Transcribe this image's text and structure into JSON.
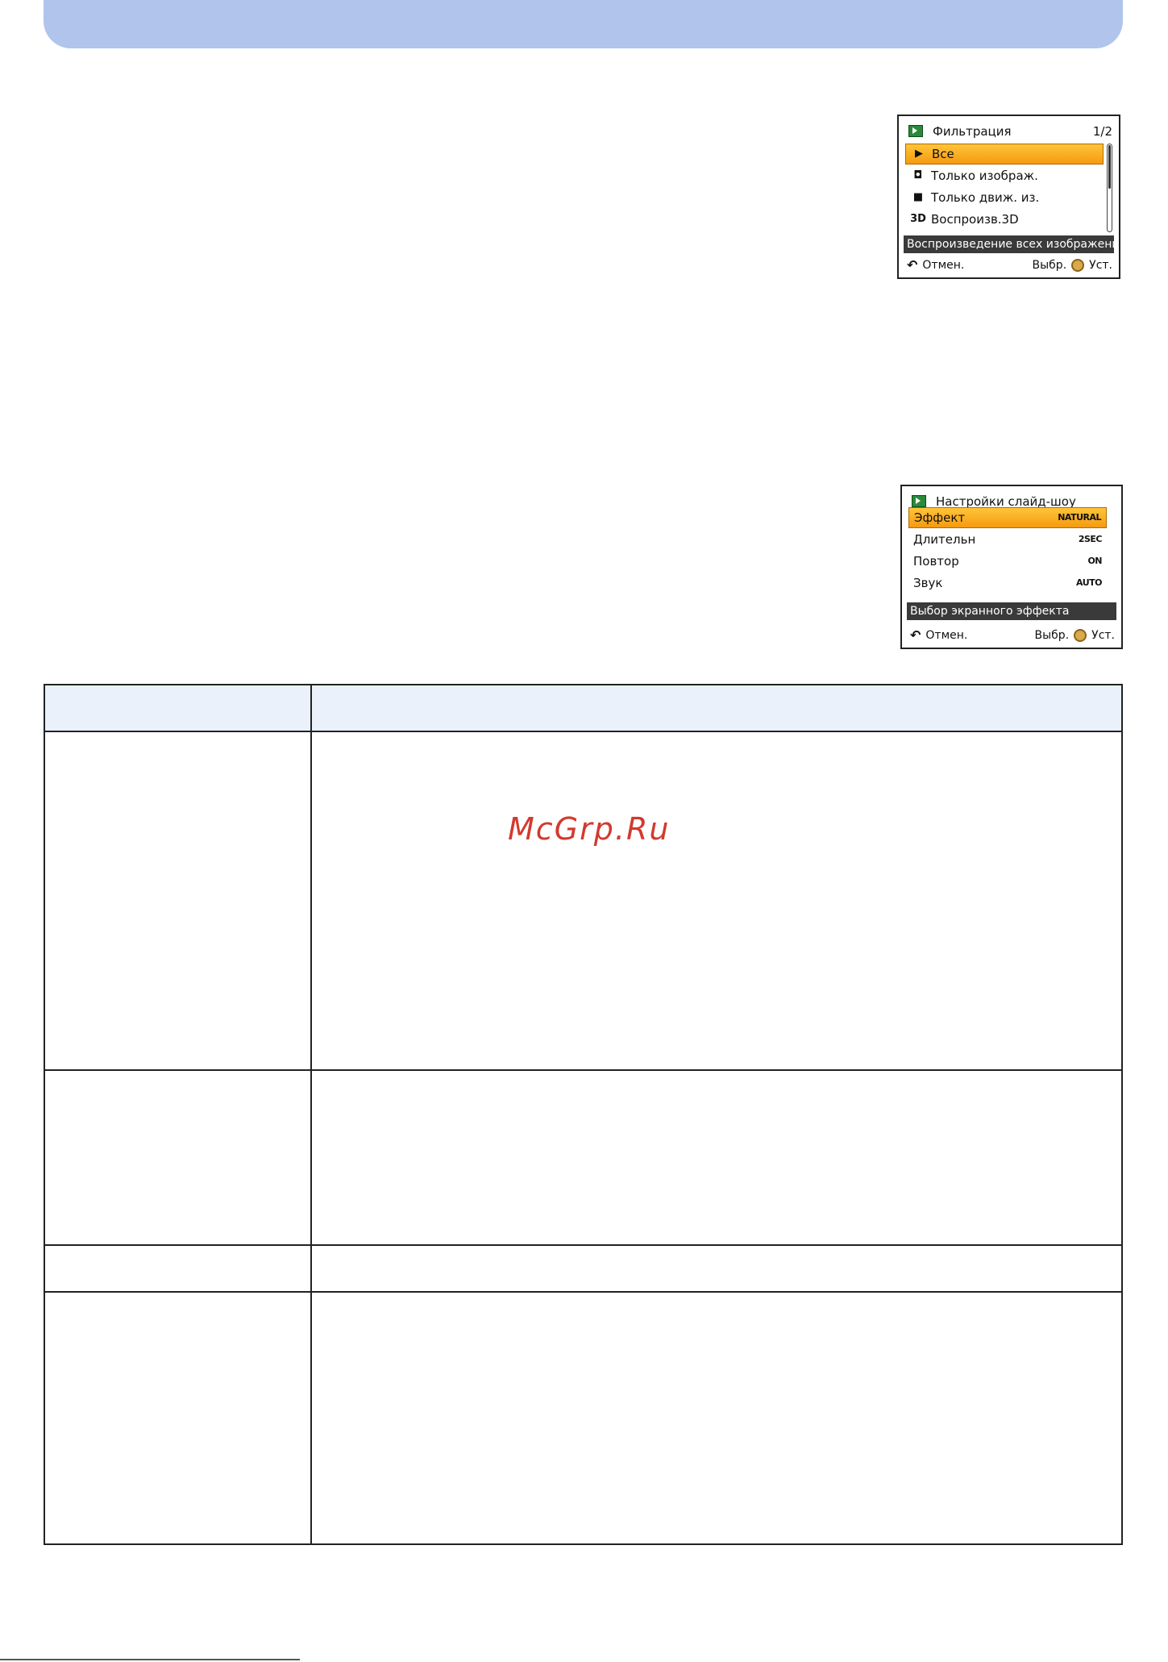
{
  "watermark": "McGrp.Ru",
  "filter_screen": {
    "title": "Фильтрация",
    "page": "1/2",
    "items": [
      {
        "icon": "play-icon",
        "label": "Все",
        "selected": true
      },
      {
        "icon": "camera-icon",
        "label": "Только изображ.",
        "selected": false
      },
      {
        "icon": "movie-camera-icon",
        "label": "Только движ. из.",
        "selected": false
      },
      {
        "icon": "3d-icon",
        "icon_text": "3D",
        "label": "Воспроизв.3D",
        "selected": false
      }
    ],
    "description": "Воспроизведение всех изображени",
    "footer": {
      "cancel": "Отмен.",
      "select": "Выбр.",
      "set": "Уст."
    }
  },
  "slideshow_screen": {
    "title": "Настройки слайд-шоу",
    "items": [
      {
        "label": "Эффект",
        "value": "NATURAL",
        "selected": true
      },
      {
        "label": "Длительн",
        "value": "2SEC",
        "selected": false
      },
      {
        "label": "Повтор",
        "value": "ON",
        "selected": false
      },
      {
        "label": "Звук",
        "value": "AUTO",
        "selected": false
      }
    ],
    "description": "Выбор экранного эффекта",
    "footer": {
      "cancel": "Отмен.",
      "select": "Выбр.",
      "set": "Уст."
    }
  },
  "colors": {
    "header_band": "#b0c4ec",
    "highlight": "#f5a623",
    "table_header": "#eaf1fb",
    "watermark": "#d23a2e"
  }
}
